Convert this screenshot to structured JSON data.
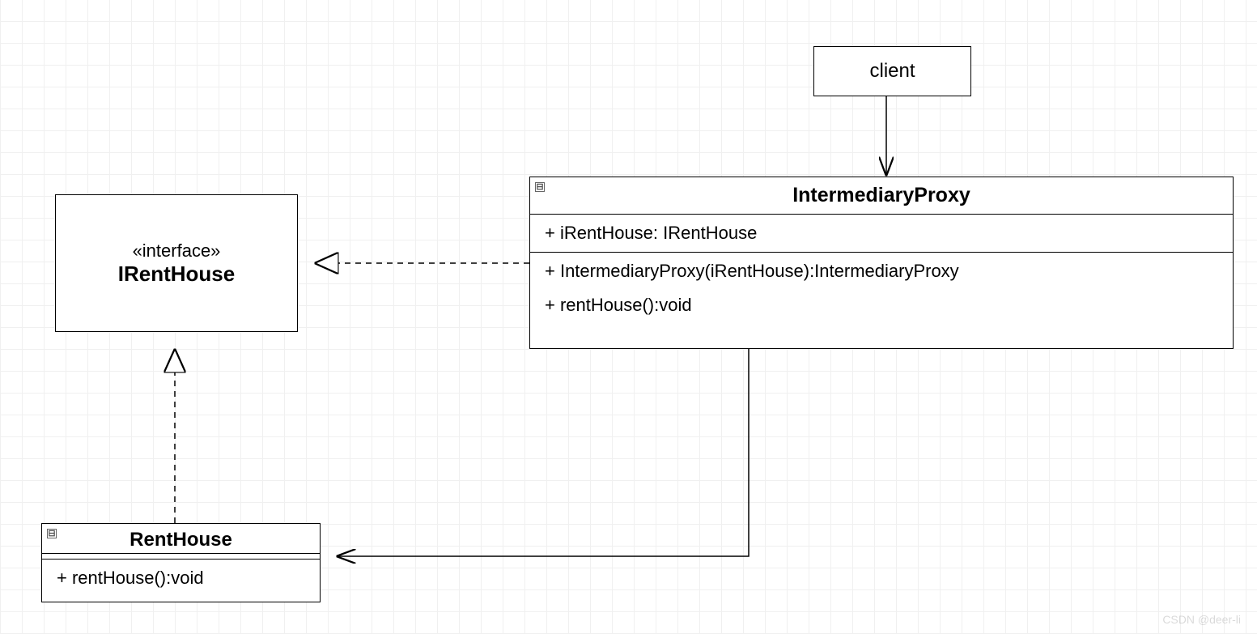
{
  "client": {
    "label": "client"
  },
  "interface": {
    "stereotype": "«interface»",
    "name": "IRentHouse"
  },
  "proxy": {
    "name": "IntermediaryProxy",
    "attribute": "+ iRentHouse: IRentHouse",
    "op1": "+ IntermediaryProxy(iRentHouse):IntermediaryProxy",
    "op2": "+ rentHouse():void",
    "collapse": "⊟"
  },
  "renthouse": {
    "name": "RentHouse",
    "op": "+ rentHouse():void",
    "collapse": "⊟"
  },
  "watermark": "CSDN @deer-li"
}
